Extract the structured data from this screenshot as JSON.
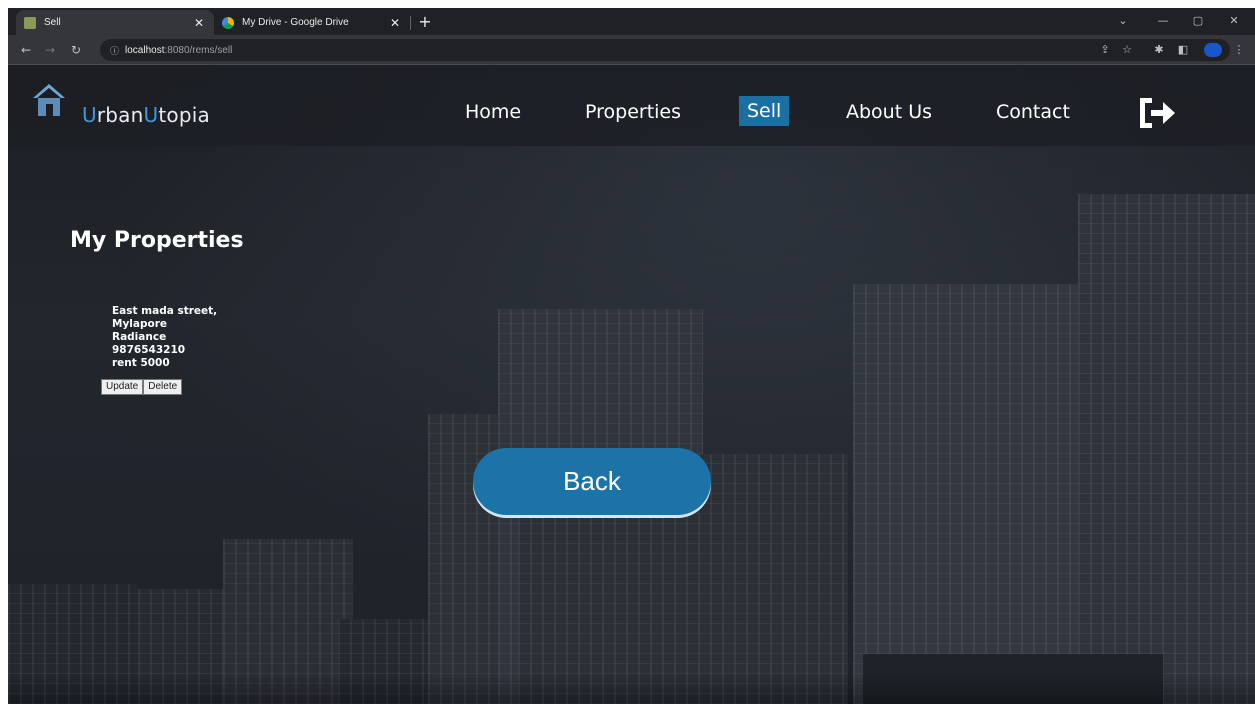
{
  "browser": {
    "tabs": [
      {
        "title": "Sell",
        "favicon_color": "#8a9a5b",
        "active": true
      },
      {
        "title": "My Drive - Google Drive",
        "favicon_color": "#f4b400",
        "active": false
      }
    ],
    "new_tab_icon": "plus-icon",
    "address": {
      "host": "localhost",
      "path": ":8080/rems/sell"
    }
  },
  "navbar": {
    "brand_u1": "U",
    "brand_rest1": "rban",
    "brand_u2": "U",
    "brand_rest2": "topia",
    "items": [
      {
        "label": "Home",
        "active": false
      },
      {
        "label": "Properties",
        "active": false
      },
      {
        "label": "Sell",
        "active": true
      },
      {
        "label": "About Us",
        "active": false
      },
      {
        "label": "Contact",
        "active": false
      }
    ],
    "logout_icon": "logout-icon",
    "accent_color": "#1b6fa3"
  },
  "main": {
    "section_title": "My Properties",
    "property": {
      "lines": [
        "East mada street,",
        "Mylapore",
        "Radiance",
        "9876543210",
        "rent 5000"
      ],
      "update_label": "Update",
      "delete_label": "Delete"
    },
    "back_label": "Back"
  }
}
